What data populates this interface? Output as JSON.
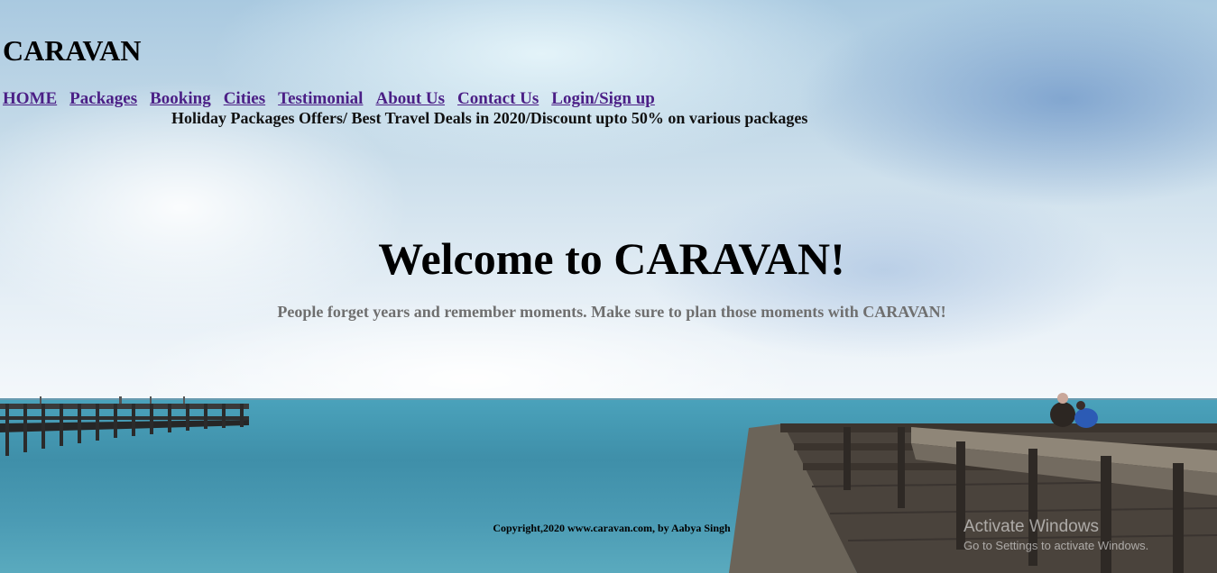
{
  "site": {
    "title": "CARAVAN"
  },
  "nav": {
    "items": [
      {
        "label": "HOME"
      },
      {
        "label": "Packages"
      },
      {
        "label": "Booking"
      },
      {
        "label": "Cities"
      },
      {
        "label": "Testimonial"
      },
      {
        "label": "About Us"
      },
      {
        "label": "Contact Us"
      },
      {
        "label": "Login/Sign up"
      }
    ]
  },
  "offers": {
    "text": "Holiday Packages Offers/ Best Travel Deals in 2020/Discount upto 50% on various packages"
  },
  "hero": {
    "heading": "Welcome to CARAVAN!",
    "tagline": "People forget years and remember moments. Make sure to plan those moments with CARAVAN!"
  },
  "footer": {
    "copyright": "Copyright,2020 www.caravan.com, by Aabya Singh"
  },
  "watermark": {
    "line1": "Activate Windows",
    "line2": "Go to Settings to activate Windows."
  },
  "colors": {
    "link": "#4b1f86",
    "tagline": "#6f6f6f",
    "sea": "#3f8fa9"
  }
}
